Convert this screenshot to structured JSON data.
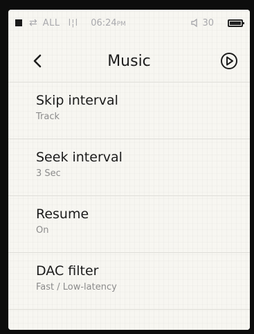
{
  "status": {
    "mode": "ALL",
    "eq": "l¦l",
    "time": "06:24",
    "time_suffix": "PM",
    "volume": "30"
  },
  "header": {
    "title": "Music"
  },
  "menu": {
    "items": [
      {
        "label": "Skip interval",
        "value": "Track"
      },
      {
        "label": "Seek interval",
        "value": "3 Sec"
      },
      {
        "label": "Resume",
        "value": "On"
      },
      {
        "label": "DAC filter",
        "value": "Fast / Low-latency"
      }
    ]
  }
}
